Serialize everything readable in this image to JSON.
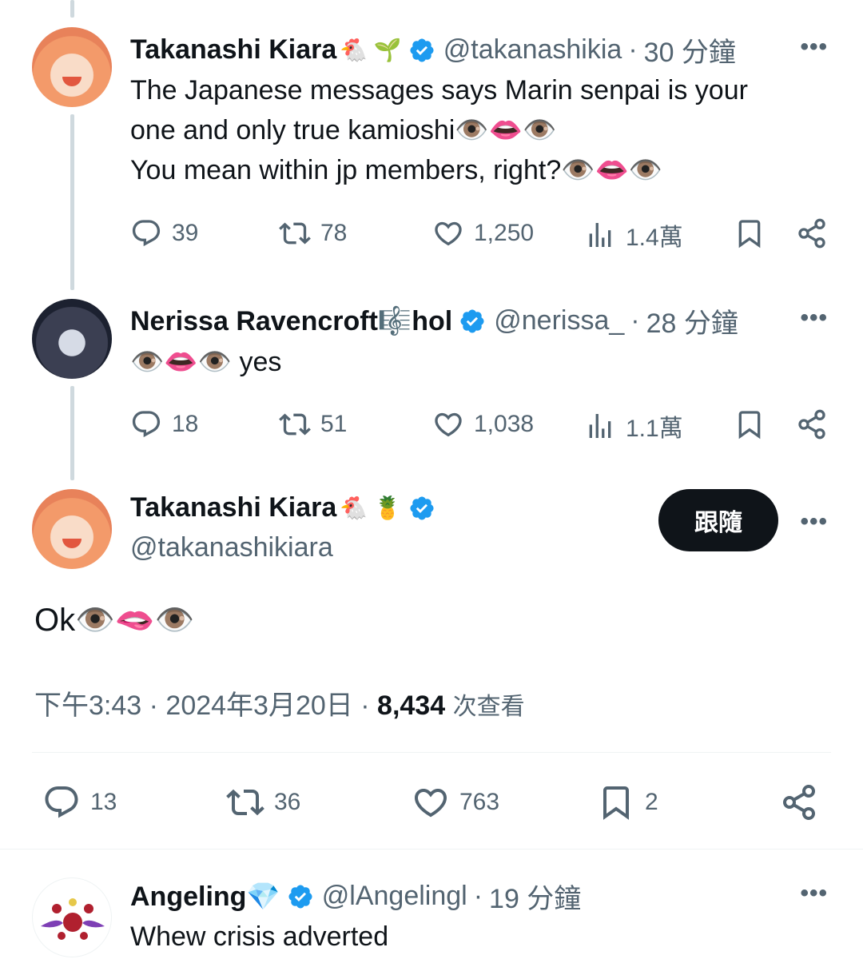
{
  "tweets": [
    {
      "name": "Takanashi Kiara",
      "badge": "🐔 🌱",
      "handle": "@takanashikia",
      "time": "30 分鐘",
      "lines": [
        "The Japanese messages says Marin senpai is your",
        "one and only true kamioshi👁️👄👁️",
        "You mean within jp members, right?👁️👄👁️"
      ],
      "stats": {
        "replies": "39",
        "retweets": "78",
        "likes": "1,250",
        "views": "1.4萬"
      }
    },
    {
      "name": "Nerissa Ravencroft🎼hol",
      "badge": "",
      "handle": "@nerissa_",
      "time": "28 分鐘",
      "lines": [
        "👁️👄👁️ yes"
      ],
      "stats": {
        "replies": "18",
        "retweets": "51",
        "likes": "1,038",
        "views": "1.1萬"
      }
    }
  ],
  "main_tweet": {
    "name": "Takanashi Kiara",
    "badge": "🐔 🍍",
    "handle": "@takanashikiara",
    "follow_label": "跟隨",
    "text": "Ok👁️🫦👁️",
    "time": "下午3:43",
    "date": "2024年3月20日",
    "views": "8,434",
    "views_label": "次查看",
    "stats": {
      "replies": "13",
      "retweets": "36",
      "likes": "763",
      "bookmarks": "2"
    }
  },
  "reply": {
    "name": "Angeling💎",
    "handle": "@lAngelingl",
    "time": "19 分鐘",
    "text": "Whew crisis adverted"
  },
  "ui": {
    "more": "•••",
    "dot": "·",
    "accent": "#1d9bf0"
  }
}
